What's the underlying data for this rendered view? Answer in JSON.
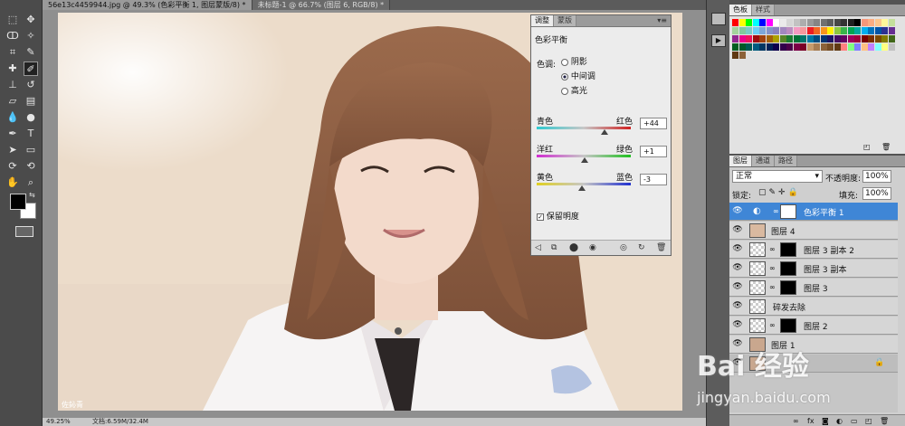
{
  "doc_tabs": [
    "56e13c4459944.jpg @ 49.3% (色彩平衡 1, 图层蒙版/8) *",
    "未标题-1 @ 66.7% (图层 6, RGB/8) *"
  ],
  "status": {
    "zoom": "49.25%",
    "doc_size": "文档:6.59M/32.4M"
  },
  "adj_panel": {
    "tabs": [
      "调整",
      "蒙版"
    ],
    "title": "色彩平衡",
    "tone_label": "色调:",
    "tones": [
      "阴影",
      "中间调",
      "高光"
    ],
    "selected_tone": "中间调",
    "sliders": [
      {
        "left": "青色",
        "right": "红色",
        "value": "+44",
        "fraction": 0.72
      },
      {
        "left": "洋红",
        "right": "绿色",
        "value": "+1",
        "fraction": 0.505
      },
      {
        "left": "黄色",
        "right": "蓝色",
        "value": "-3",
        "fraction": 0.485
      }
    ],
    "preserve_luminosity": "保留明度",
    "preserve_checked": true
  },
  "swatches_panel": {
    "tabs": [
      "色板",
      "样式"
    ]
  },
  "layers_panel": {
    "tabs": [
      "图层",
      "通道",
      "路径"
    ],
    "blend_mode": "正常",
    "opacity_label": "不透明度:",
    "opacity": "100%",
    "lock_label": "锁定:",
    "fill_label": "填充:",
    "fill": "100%",
    "layers": [
      {
        "name": "色彩平衡 1",
        "selected": true
      },
      {
        "name": "图层 4",
        "selected": false
      },
      {
        "name": "图层 3 副本 2",
        "selected": false
      },
      {
        "name": "图层 3 副本",
        "selected": false
      },
      {
        "name": "图层 3",
        "selected": false
      },
      {
        "name": "碎发去除",
        "selected": false
      },
      {
        "name": "图层 2",
        "selected": false
      },
      {
        "name": "图层 1",
        "selected": false
      }
    ]
  },
  "watermark": {
    "brand": "Bai 经验",
    "url": "jingyan.baidu.com"
  },
  "photo_caption": "佐鈊青",
  "colors": {
    "selected_layer": "#3f86d6",
    "panel_bg": "#ececec",
    "dark_ui": "#4b4b4b"
  }
}
